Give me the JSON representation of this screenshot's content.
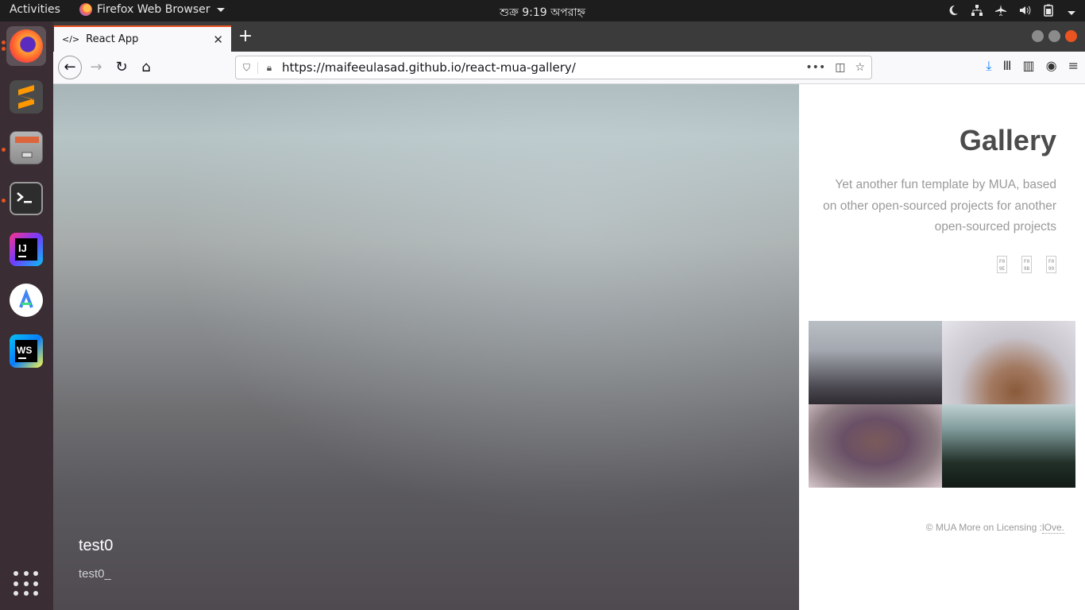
{
  "topbar": {
    "activities": "Activities",
    "app_name": "Firefox Web Browser",
    "clock": "শুক্র  9:19 অপরাহ্ন"
  },
  "dock": {
    "items": [
      {
        "name": "firefox",
        "color": "#ff7139"
      },
      {
        "name": "sublime-text",
        "color": "#ff9800"
      },
      {
        "name": "file-manager",
        "color": "#9a9a9a"
      },
      {
        "name": "terminal",
        "color": "#2b2b2b"
      },
      {
        "name": "intellij-idea",
        "color": "#6f3cff"
      },
      {
        "name": "android-studio",
        "color": "#3ddc84"
      },
      {
        "name": "webstorm",
        "color": "#07c3f2"
      }
    ]
  },
  "browser": {
    "tab_icon": "</>",
    "tab_title": "React App",
    "url": "https://maifeeulasad.github.io/react-mua-gallery/"
  },
  "page": {
    "hero_title": "test0",
    "hero_subtitle": "test0_",
    "gallery_title": "Gallery",
    "tagline": "Yet another fun template by MUA, based on other open-sourced projects for another open-sourced projects",
    "footer_copyright": "© MUA",
    "footer_more": "More on Licensing :",
    "footer_link": "lOve."
  }
}
